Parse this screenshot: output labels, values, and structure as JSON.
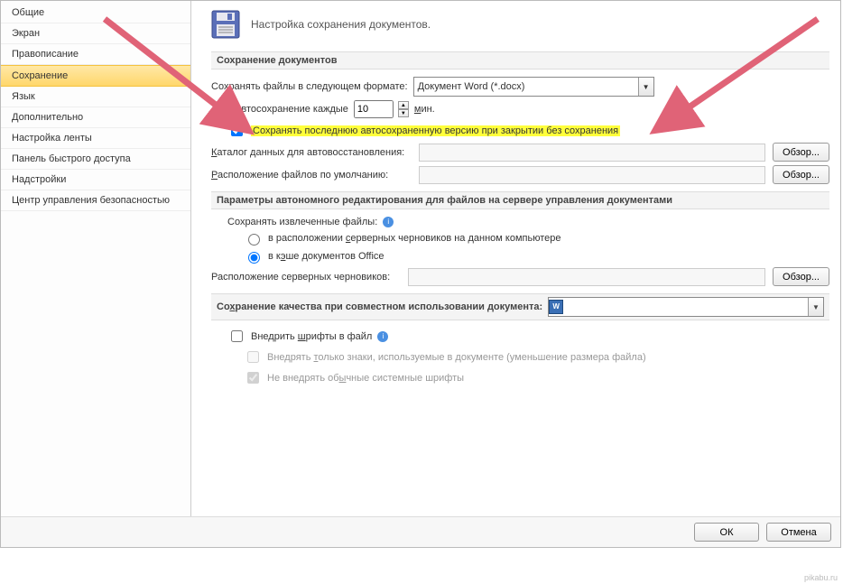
{
  "sidebar": {
    "items": [
      {
        "label": "Общие"
      },
      {
        "label": "Экран"
      },
      {
        "label": "Правописание"
      },
      {
        "label": "Сохранение",
        "selected": true
      },
      {
        "label": "Язык"
      },
      {
        "label": "Дополнительно"
      },
      {
        "label": "Настройка ленты"
      },
      {
        "label": "Панель быстрого доступа"
      },
      {
        "label": "Надстройки"
      },
      {
        "label": "Центр управления безопасностью"
      }
    ]
  },
  "heading": {
    "icon": "floppy-icon",
    "text": "Настройка сохранения документов."
  },
  "sections": {
    "save_docs": {
      "title": "Сохранение документов",
      "format_label": "Сохранять файлы в следующем формате:",
      "format_value": "Документ Word (*.docx)",
      "autosave_label": "Автосохранение каждые",
      "autosave_checked": true,
      "autosave_value": "10",
      "autosave_unit": "мин.",
      "keep_last_autosaved_label": "Сохранять последнюю автосохраненную версию при закрытии без сохранения",
      "keep_last_autosaved_checked": true,
      "autorecover_path_label": "Каталог данных для автовосстановления:",
      "default_path_label": "Расположение файлов по умолчанию:",
      "browse_label": "Обзор..."
    },
    "offline": {
      "title": "Параметры автономного редактирования для файлов на сервере управления документами",
      "save_checked_out_label": "Сохранять извлеченные файлы:",
      "option_server_drafts": "в расположении серверных черновиков на данном компьютере",
      "option_office_cache": "в кэше документов Office",
      "selected_option": "cache",
      "server_drafts_path_label": "Расположение серверных черновиков:",
      "browse_label": "Обзор..."
    },
    "fidelity": {
      "title": "Сохранение качества при совместном использовании документа:",
      "doc_dropdown_value": "",
      "embed_fonts_label": "Внедрить шрифты в файл",
      "embed_fonts_checked": false,
      "embed_used_label": "Внедрять только знаки, используемые в документе (уменьшение размера файла)",
      "embed_skip_system_label": "Не внедрять обычные системные шрифты"
    }
  },
  "dialog_buttons": {
    "ok": "ОК",
    "cancel": "Отмена"
  },
  "branding": "pikabu.ru"
}
